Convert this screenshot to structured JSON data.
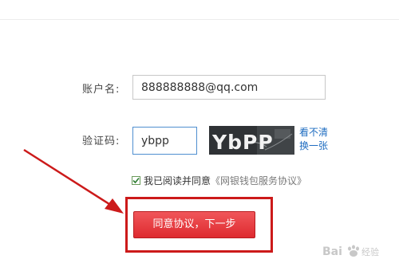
{
  "form": {
    "account_label": "账户名:",
    "account_value": "888888888@qq.com",
    "captcha_label": "验证码:",
    "captcha_value": "ybpp",
    "captcha_image_text": "YbPP",
    "captcha_refresh_line1": "看不清",
    "captcha_refresh_line2": "换一张",
    "agree_text": "我已阅读并同意",
    "agree_link": "《网银钱包服务协议》",
    "agree_checked": true,
    "submit_label": "同意协议，下一步"
  },
  "annotations": {
    "color": "#cc1a1a"
  },
  "watermark": {
    "text": "Baidu经验"
  }
}
